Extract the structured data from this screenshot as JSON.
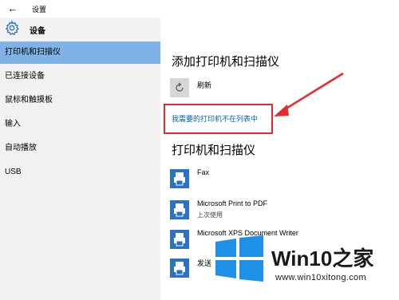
{
  "window": {
    "back_glyph": "←",
    "title": "设置"
  },
  "sidebar": {
    "header_label": "设备",
    "items": [
      {
        "label": "打印机和扫描仪",
        "active": true
      },
      {
        "label": "已连接设备",
        "active": false
      },
      {
        "label": "鼠标和触摸板",
        "active": false
      },
      {
        "label": "输入",
        "active": false
      },
      {
        "label": "自动播放",
        "active": false
      },
      {
        "label": "USB",
        "active": false
      }
    ]
  },
  "main": {
    "add_section_title": "添加打印机和扫描仪",
    "refresh_label": "刷新",
    "missing_printer_link": "我需要的打印机不在列表中",
    "printers_section_title": "打印机和扫描仪",
    "printers": [
      {
        "name": "Fax",
        "status": ""
      },
      {
        "name": "Microsoft Print to PDF",
        "status": "上次使用"
      },
      {
        "name": "Microsoft XPS Document Writer",
        "status": ""
      },
      {
        "name": "发送",
        "status": ""
      }
    ]
  },
  "watermark": {
    "brand_main": "Win10",
    "brand_suffix": "之家",
    "url": "www.win10xitong.com"
  },
  "colors": {
    "sidebar_bg": "#f2f2f2",
    "active_item": "#7fb2e5",
    "link": "#0063b1",
    "highlight": "#e8282a",
    "printer_icon": "#2b72c2",
    "logo_blue": "#1e90e8"
  }
}
